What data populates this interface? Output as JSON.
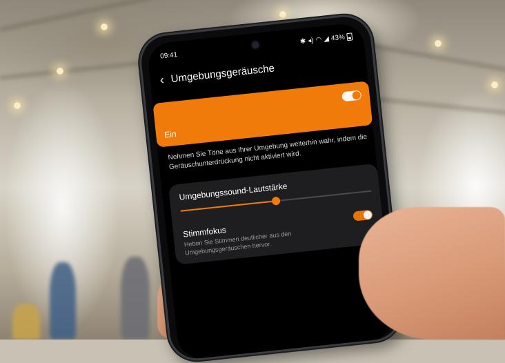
{
  "status_bar": {
    "time": "09:41",
    "icons": [
      "bluetooth-icon",
      "mute-icon",
      "wifi-icon",
      "signal-icon"
    ],
    "battery": "43%"
  },
  "header": {
    "back_icon": "chevron-left-icon",
    "title": "Umgebungsgeräusche"
  },
  "master_switch": {
    "label": "Ein",
    "on": true,
    "accent": "#f07b0a"
  },
  "description": "Nehmen Sie Töne aus Ihrer Umgebung weiterhin wahr, indem die Geräuschunterdrückung nicht aktiviert wird.",
  "volume": {
    "label": "Umgebungssound-Lautstärke",
    "level": 0.5
  },
  "voice_focus": {
    "label": "Stimmfokus",
    "description": "Heben Sie Stimmen deutlicher aus den Umgebungsgeräuschen hervor.",
    "on": true
  },
  "colors": {
    "accent": "#f07b0a",
    "screen_bg": "#000000",
    "panel_bg": "#1e1e20"
  }
}
